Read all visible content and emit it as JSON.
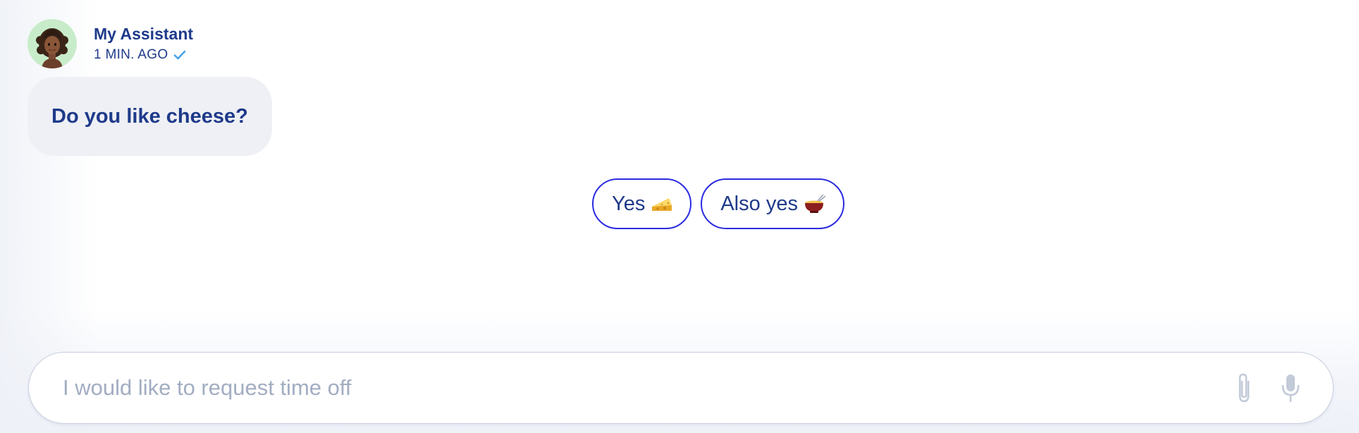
{
  "assistant": {
    "name": "My Assistant",
    "timestamp": "1 MIN. AGO",
    "avatar_icon": "woman-avatar-icon",
    "status_icon": "check-icon"
  },
  "message": {
    "text": "Do you like cheese?"
  },
  "quick_replies": [
    {
      "label": "Yes",
      "icon": "cheese-icon"
    },
    {
      "label": "Also yes",
      "icon": "fondue-icon"
    }
  ],
  "composer": {
    "placeholder": "I would like to request time off",
    "value": "",
    "attach_icon": "paperclip-icon",
    "mic_icon": "microphone-icon"
  },
  "colors": {
    "text_primary": "#1e3a8a",
    "bubble_bg": "#eef0f5",
    "button_border": "#2b2be0",
    "avatar_bg": "#c8ecc9",
    "check": "#4aa3e8",
    "placeholder": "#a2adc2"
  }
}
